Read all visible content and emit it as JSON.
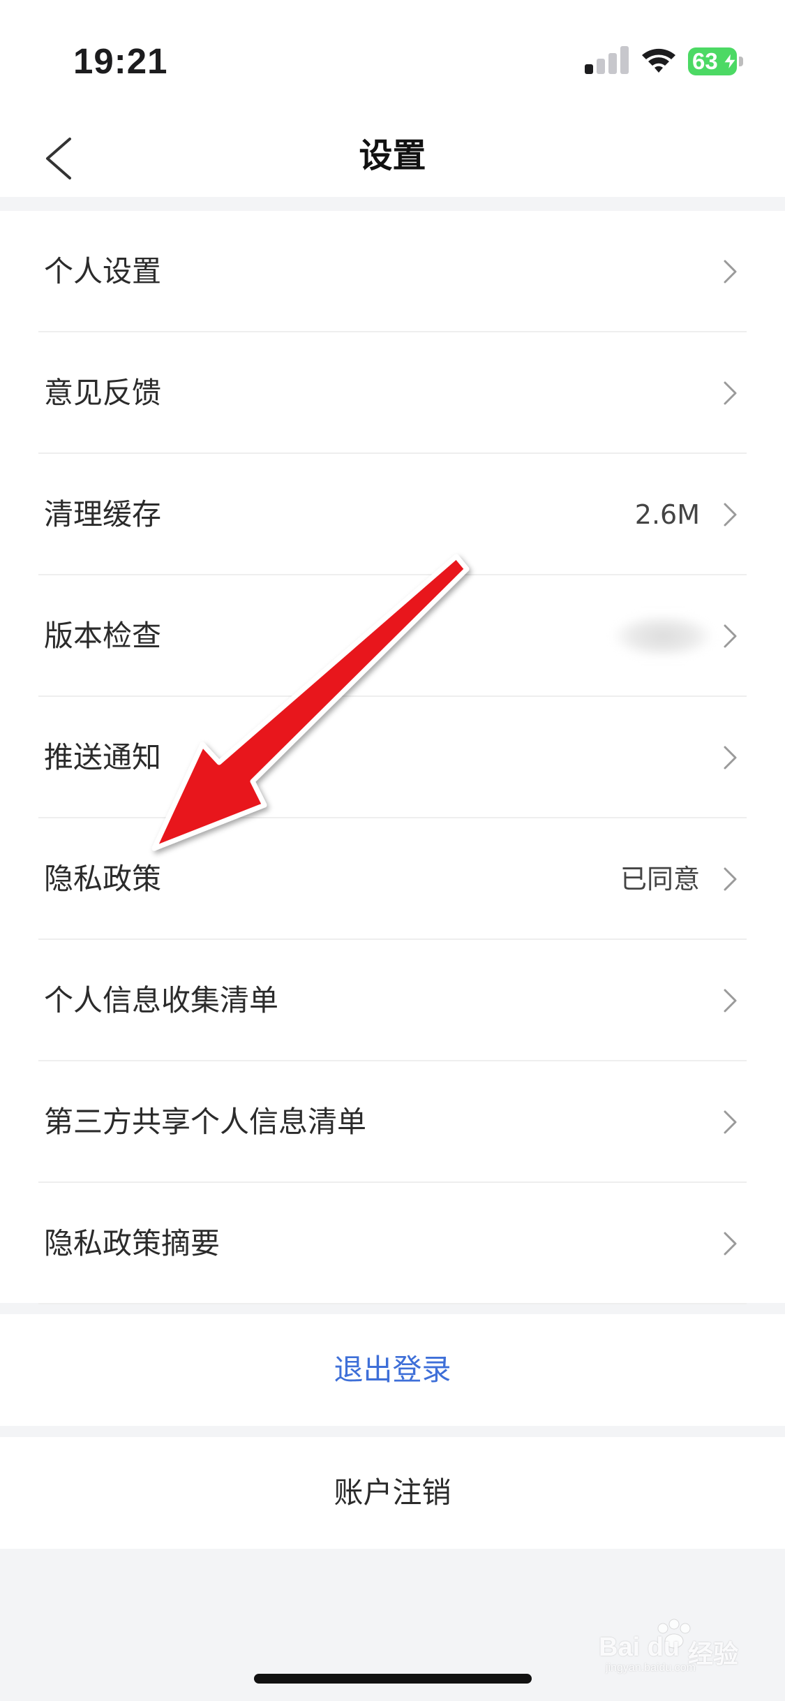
{
  "status_bar": {
    "time": "19:21",
    "battery_level": "63",
    "signal_bars_active": 1,
    "signal_bars_total": 4,
    "icons": [
      "signal-icon",
      "wifi-icon",
      "battery-icon",
      "charging-bolt-icon"
    ]
  },
  "nav": {
    "title": "设置",
    "back_icon": "chevron-left-icon"
  },
  "settings": {
    "items": [
      {
        "label": "个人设置",
        "value": ""
      },
      {
        "label": "意见反馈",
        "value": ""
      },
      {
        "label": "清理缓存",
        "value": "2.6M"
      },
      {
        "label": "版本检查",
        "value": "",
        "value_obscured": true
      },
      {
        "label": "推送通知",
        "value": ""
      },
      {
        "label": "隐私政策",
        "value": "已同意"
      },
      {
        "label": "个人信息收集清单",
        "value": ""
      },
      {
        "label": "第三方共享个人信息清单",
        "value": ""
      },
      {
        "label": "隐私政策摘要",
        "value": ""
      }
    ],
    "row_icon": "chevron-right-icon"
  },
  "actions": {
    "logout": "退出登录",
    "cancel_account": "账户注销"
  },
  "annotation": {
    "icon": "red-arrow-annotation",
    "color": "#e8141a"
  },
  "watermark": {
    "brand": "Bai du",
    "product": "经验",
    "url": "jingyan.baidu.com"
  },
  "colors": {
    "accent": "#3e6fd8",
    "background": "#f3f4f6",
    "battery": "#4cd964"
  }
}
